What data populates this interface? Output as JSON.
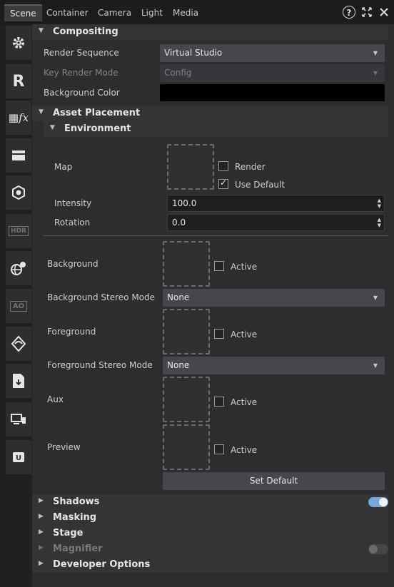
{
  "tabs": [
    "Scene",
    "Container",
    "Camera",
    "Light",
    "Media"
  ],
  "header_icons": [
    "help-icon",
    "expand-icon",
    "close-icon"
  ],
  "sidebar": [
    {
      "name": "gear-icon",
      "glyph": "⚙",
      "dim": false
    },
    {
      "name": "render-r-icon",
      "glyph": "R",
      "dim": false
    },
    {
      "name": "fx-icon",
      "glyph": "𝑓x",
      "dim": false
    },
    {
      "name": "layers-icon",
      "glyph": "▬",
      "dim": false
    },
    {
      "name": "scene-object-icon",
      "glyph": "⬡",
      "dim": false
    },
    {
      "name": "hdr-icon",
      "glyph": "HDR",
      "dim": true
    },
    {
      "name": "globe-light-icon",
      "glyph": "◐",
      "dim": false
    },
    {
      "name": "ao-icon",
      "glyph": "AO",
      "dim": true
    },
    {
      "name": "refraction-icon",
      "glyph": "◇",
      "dim": false
    },
    {
      "name": "export-file-icon",
      "glyph": "🗎",
      "dim": false
    },
    {
      "name": "devices-icon",
      "glyph": "▭",
      "dim": false
    },
    {
      "name": "unreal-icon",
      "glyph": "U",
      "dim": false
    }
  ],
  "compositing": {
    "title": "Compositing",
    "render_sequence_label": "Render Sequence",
    "render_sequence_value": "Virtual Studio",
    "key_render_mode_label": "Key Render Mode",
    "key_render_mode_value": "Config",
    "background_color_label": "Background Color",
    "background_color": "#000000"
  },
  "asset_placement": {
    "title": "Asset Placement",
    "environment_title": "Environment",
    "map_label": "Map",
    "render_label": "Render",
    "use_default_label": "Use Default",
    "intensity_label": "Intensity",
    "intensity_value": "100.0",
    "rotation_label": "Rotation",
    "rotation_value": "0.0",
    "background_label": "Background",
    "active_label": "Active",
    "background_stereo_label": "Background Stereo Mode",
    "background_stereo_value": "None",
    "foreground_label": "Foreground",
    "foreground_stereo_label": "Foreground Stereo Mode",
    "foreground_stereo_value": "None",
    "aux_label": "Aux",
    "preview_label": "Preview",
    "set_default_label": "Set Default"
  },
  "collapsed_sections": {
    "shadows": "Shadows",
    "masking": "Masking",
    "stage": "Stage",
    "magnifier": "Magnifier",
    "developer_options": "Developer Options"
  },
  "toggles": {
    "shadows_on": true,
    "magnifier_on": false
  },
  "colors": {
    "toggle_on": "#7aa7d6",
    "toggle_off": "#444648"
  }
}
